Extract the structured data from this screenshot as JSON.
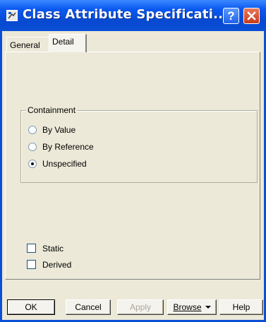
{
  "window": {
    "title": "Class Attribute Specificati...",
    "icon": "app-icon",
    "help_glyph": "?",
    "close_glyph": "close-x-icon"
  },
  "tabs": [
    {
      "label": "General",
      "selected": false
    },
    {
      "label": "Detail",
      "selected": true
    }
  ],
  "containment": {
    "label": "Containment",
    "options": [
      {
        "label": "By Value",
        "checked": false
      },
      {
        "label": "By Reference",
        "checked": false
      },
      {
        "label": "Unspecified",
        "checked": true
      }
    ]
  },
  "checkboxes": [
    {
      "label": "Static",
      "checked": false
    },
    {
      "label": "Derived",
      "checked": false
    }
  ],
  "buttons": {
    "ok": "OK",
    "cancel": "Cancel",
    "apply": "Apply",
    "browse": "Browse",
    "help": "Help"
  },
  "colors": {
    "titlebar": "#0a4fd6",
    "dialog_bg": "#ece9d8",
    "close_button": "#c9391a"
  }
}
